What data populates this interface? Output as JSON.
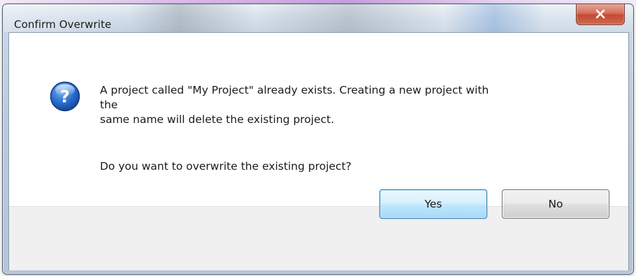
{
  "window": {
    "title": "Confirm Overwrite",
    "close_glyph": "x"
  },
  "message": {
    "line1": "A project called \"My Project\" already exists.  Creating a new project with",
    "line2": "the",
    "line3": "same name will delete the existing project.",
    "question": "Do you want to overwrite the existing project?"
  },
  "buttons": {
    "yes_label": "Yes",
    "no_label": "No"
  },
  "icons": {
    "dialog_icon": "question-icon",
    "close_icon": "close-icon"
  },
  "colors": {
    "default_button_border": "#3c7fb1",
    "close_button": "#c44a33",
    "question_icon": "#1f5fbf"
  }
}
